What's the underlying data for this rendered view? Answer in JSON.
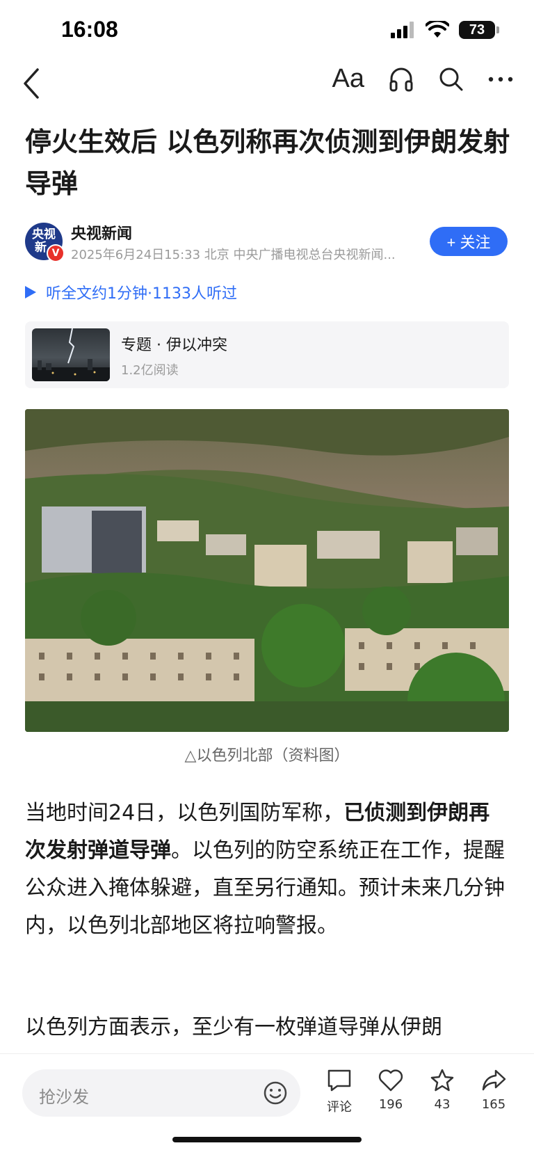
{
  "status_bar": {
    "time": "16:08",
    "battery": "73"
  },
  "nav": {
    "font_icon_text": "Aa"
  },
  "article": {
    "title": "停火生效后 以色列称再次侦测到伊朗发射导弹",
    "author": {
      "avatar_text_1": "央视",
      "avatar_text_2": "新",
      "verified_badge": "V",
      "name": "央视新闻",
      "meta": "2025年6月24日15:33 北京 中央广播电视总台央视新闻..."
    },
    "follow_label": "+ 关注",
    "listen": "听全文约1分钟·1133人听过",
    "topic": {
      "title": "专题 · 伊以冲突",
      "reads": "1.2亿阅读"
    },
    "image_caption": "△以色列北部（资料图）",
    "paragraph1": {
      "before": "当地时间24日，以色列国防军称，",
      "bold": "已侦测到伊朗再次发射弹道导弹",
      "after": "。以色列的防空系统正在工作，提醒公众进入掩体躲避，直至另行通知。预计未来几分钟内，以色列北部地区将拉响警报。"
    },
    "paragraph2": "以色列方面表示，至少有一枚弹道导弹从伊朗"
  },
  "bottom_bar": {
    "comment_placeholder": "抢沙发",
    "actions": [
      {
        "label": "评论",
        "icon": "comment-icon"
      },
      {
        "label": "196",
        "icon": "heart-icon"
      },
      {
        "label": "43",
        "icon": "star-icon"
      },
      {
        "label": "165",
        "icon": "share-icon"
      }
    ]
  },
  "colors": {
    "accent": "#2f6df6",
    "badge_red": "#e8312a",
    "avatar_bg": "#1f3a8a"
  }
}
